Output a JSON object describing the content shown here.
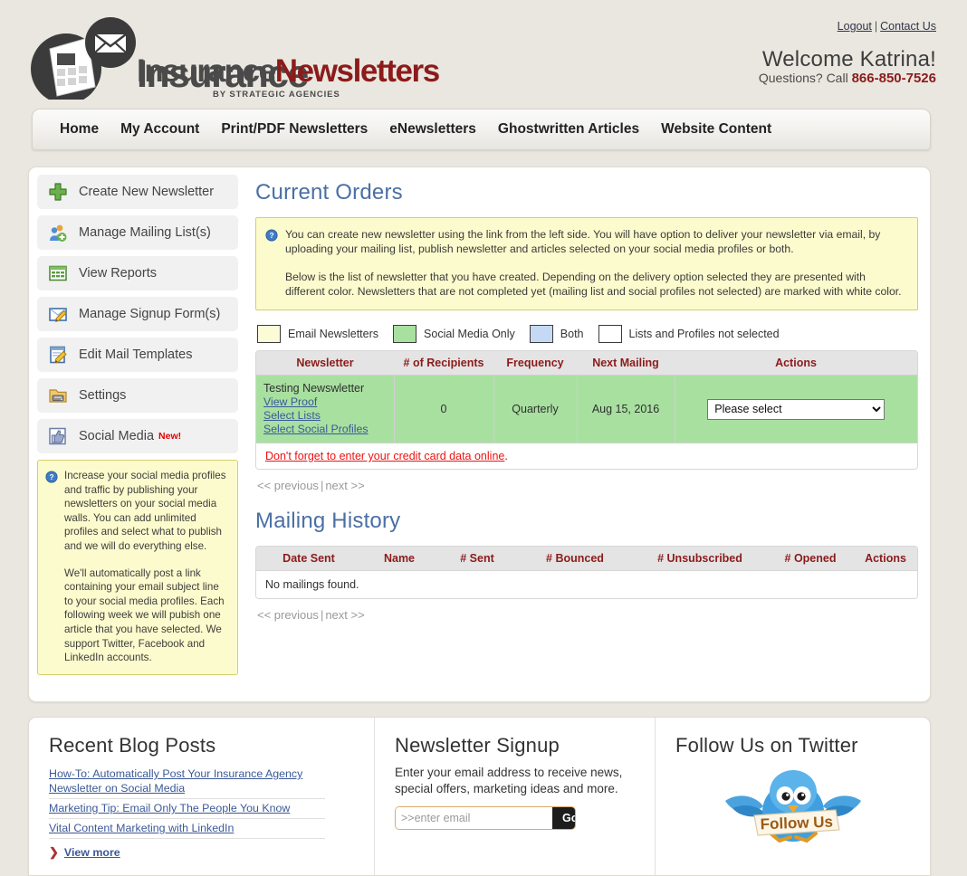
{
  "header": {
    "logo_main": "Insurance",
    "logo_accent": "Newsletters",
    "logo_sub": "BY STRATEGIC AGENCIES",
    "logout": "Logout",
    "separator": "|",
    "contact_us": "Contact Us",
    "welcome": "Welcome Katrina!",
    "questions_label": "Questions? Call",
    "phone": "866-850-7526"
  },
  "nav": {
    "items": [
      {
        "label": "Home"
      },
      {
        "label": "My Account"
      },
      {
        "label": "Print/PDF Newsletters"
      },
      {
        "label": "eNewsletters"
      },
      {
        "label": "Ghostwritten Articles"
      },
      {
        "label": "Website Content"
      }
    ]
  },
  "sidebar": {
    "items": [
      {
        "label": "Create New Newsletter",
        "icon": "plus-green-icon"
      },
      {
        "label": "Manage Mailing List(s)",
        "icon": "users-add-icon"
      },
      {
        "label": "View Reports",
        "icon": "grid-report-icon"
      },
      {
        "label": "Manage Signup Form(s)",
        "icon": "form-pencil-icon"
      },
      {
        "label": "Edit Mail Templates",
        "icon": "template-pencil-icon"
      },
      {
        "label": "Settings",
        "icon": "settings-folder-icon"
      },
      {
        "label": "Social Media",
        "icon": "thumbs-up-icon",
        "badge": "New!"
      }
    ],
    "note": {
      "paragraph1": "Increase your social media profiles and traffic by publishing your newsletters on your social media walls. You can add unlimited profiles and select what to publish and we will do everything else.",
      "paragraph2": "We'll automatically post a link containing your email subject line to your social media profiles. Each following week we will pubish one article that you have selected. We support Twitter, Facebook and LinkedIn accounts."
    }
  },
  "main": {
    "current_orders_title": "Current Orders",
    "notice": {
      "paragraph1": "You can create new newsletter using the link from the left side. You will have option to deliver your newsletter via email, by uploading your mailing list, publish newsletter and articles selected on your social media profiles or both.",
      "paragraph2": "Below is the list of newsletter that you have created. Depending on the delivery option selected they are presented with different color. Newsletters that are not completed yet (mailing list and social profiles not selected) are marked with white color."
    },
    "legend": [
      {
        "label": "Email Newsletters",
        "color": "#fbfbd8"
      },
      {
        "label": "Social Media Only",
        "color": "#a8e0a0"
      },
      {
        "label": "Both",
        "color": "#c5d9f5"
      },
      {
        "label": "Lists and Profiles not selected",
        "color": "#ffffff"
      }
    ],
    "orders_table": {
      "headers": [
        "Newsletter",
        "# of Recipients",
        "Frequency",
        "Next Mailing",
        "Actions"
      ],
      "row": {
        "name": "Testing Newswletter",
        "links": [
          "View Proof",
          "Select Lists",
          "Select Social Profiles"
        ],
        "recipients": "0",
        "frequency": "Quarterly",
        "next_mailing": "Aug 15, 2016",
        "action_selected": "Please select",
        "action_options": [
          "Please select"
        ]
      },
      "warning_link": "Don't forget to enter your credit card data online",
      "warning_suffix": "."
    },
    "pager": {
      "previous": "<< previous",
      "bar": "|",
      "next": "next >>"
    },
    "mailing_history_title": "Mailing History",
    "history_table": {
      "headers": [
        "Date Sent",
        "Name",
        "# Sent",
        "# Bounced",
        "# Unsubscribed",
        "# Opened",
        "Actions"
      ],
      "empty_message": "No mailings found."
    }
  },
  "footer": {
    "blog": {
      "title": "Recent Blog Posts",
      "posts": [
        "How-To: Automatically Post Your Insurance Agency Newsletter on Social Media",
        "Marketing Tip: Email Only The People You Know",
        "Vital Content Marketing with LinkedIn"
      ],
      "view_more": "View more"
    },
    "signup": {
      "title": "Newsletter Signup",
      "description": "Enter your email address to receive news, special offers, marketing ideas and more.",
      "placeholder": ">>enter email",
      "value": "",
      "go_label": "Go"
    },
    "twitter": {
      "title": "Follow Us on Twitter",
      "banner_text": "Follow Us"
    }
  },
  "colors": {
    "page_background": "#e9e7df",
    "accent_red": "#8c1b1b",
    "link_blue": "#3b5998",
    "heading_blue": "#4a6fa5",
    "notice_yellow": "#fcfbcd"
  }
}
